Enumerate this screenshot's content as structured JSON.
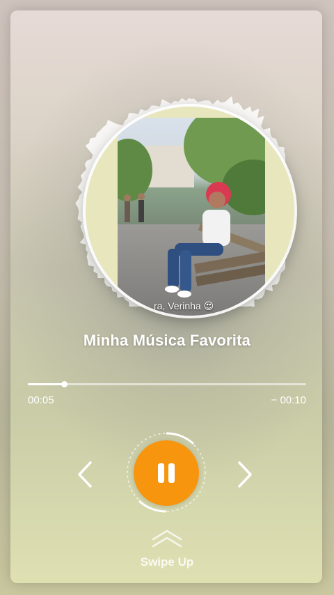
{
  "player": {
    "song_title": "Minha Música Favorita",
    "elapsed": "00:05",
    "remaining": "− 00:10",
    "progress": 0.13,
    "state": "playing",
    "accent_color": "#f7950f"
  },
  "artwork": {
    "caption": "ra, Verinha 😍"
  },
  "footer": {
    "swipe_label": "Swipe Up"
  },
  "icons": {
    "prev": "chevron-left-icon",
    "next": "chevron-right-icon",
    "pause": "pause-icon",
    "swipe": "double-chevron-up-icon"
  }
}
